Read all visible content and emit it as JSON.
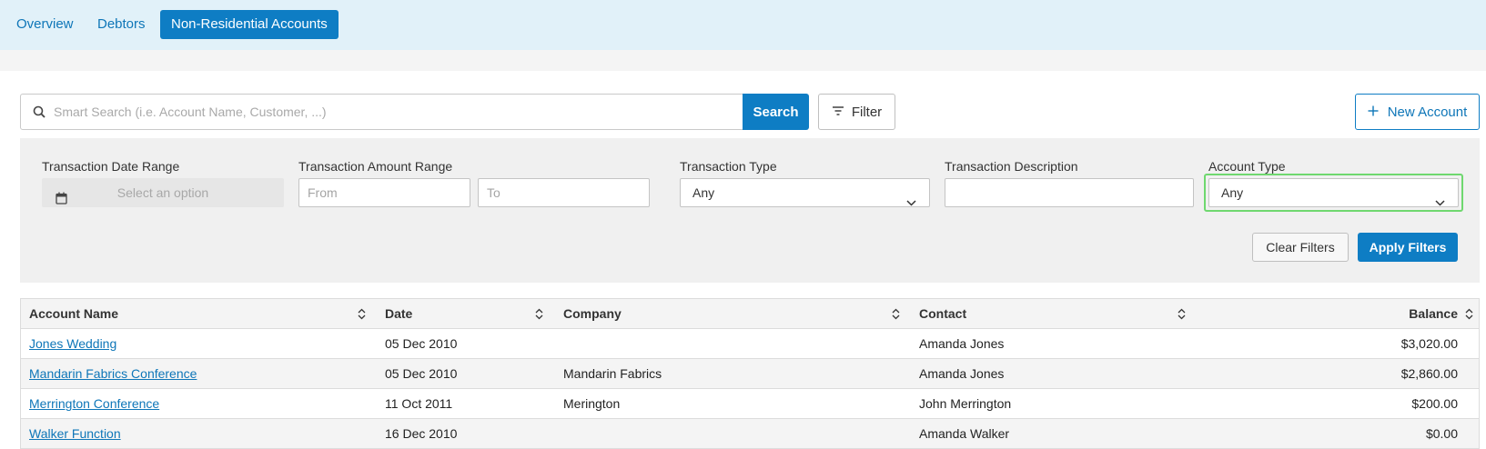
{
  "tabs": [
    {
      "label": "Overview",
      "active": false
    },
    {
      "label": "Debtors",
      "active": false
    },
    {
      "label": "Non-Residential Accounts",
      "active": true
    }
  ],
  "search": {
    "placeholder": "Smart Search (i.e. Account Name, Customer, ...)",
    "value": "",
    "button_label": "Search"
  },
  "filter_button_label": "Filter",
  "new_account_label": "New Account",
  "filters": {
    "date_range": {
      "label": "Transaction Date Range",
      "placeholder": "Select an option"
    },
    "amount_range": {
      "label": "Transaction Amount Range",
      "from_placeholder": "From",
      "to_placeholder": "To"
    },
    "type": {
      "label": "Transaction Type",
      "value": "Any"
    },
    "description": {
      "label": "Transaction Description",
      "value": ""
    },
    "account_type": {
      "label": "Account Type",
      "value": "Any"
    },
    "clear_label": "Clear Filters",
    "apply_label": "Apply Filters"
  },
  "table": {
    "columns": [
      "Account Name",
      "Date",
      "Company",
      "Contact",
      "Balance"
    ],
    "rows": [
      {
        "account": "Jones Wedding",
        "date": "05 Dec 2010",
        "company": "",
        "contact": "Amanda Jones",
        "balance": "$3,020.00"
      },
      {
        "account": "Mandarin Fabrics Conference",
        "date": "05 Dec 2010",
        "company": "Mandarin Fabrics",
        "contact": "Amanda Jones",
        "balance": "$2,860.00"
      },
      {
        "account": "Merrington Conference",
        "date": "11 Oct 2011",
        "company": "Merington",
        "contact": "John Merrington",
        "balance": "$200.00"
      },
      {
        "account": "Walker Function",
        "date": "16 Dec 2010",
        "company": "",
        "contact": "Amanda Walker",
        "balance": "$0.00"
      }
    ]
  },
  "colors": {
    "primary": "#0e7dc4",
    "link": "#0e76b8",
    "topbar": "#e1f1f9",
    "highlight": "#6fd86f"
  }
}
